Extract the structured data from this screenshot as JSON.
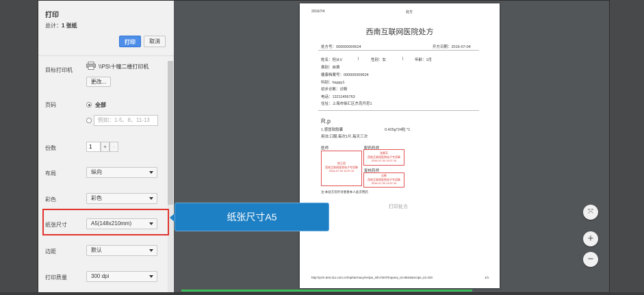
{
  "sidebar": {
    "title": "打印",
    "total_prefix": "总计：",
    "total_count": "1 张纸",
    "print_label": "打印",
    "cancel_label": "取消",
    "destination": {
      "label": "目标打印机",
      "printer": "\\\\PS\\十幢二楼打印机",
      "change_label": "更改..."
    },
    "pages": {
      "label": "页码",
      "all_label": "全部",
      "range_placeholder": "例如：1-5、8、11-13"
    },
    "copies": {
      "label": "份数",
      "value": "1",
      "plus": "+",
      "minus": "-"
    },
    "layout": {
      "label": "布局",
      "value": "纵向"
    },
    "color": {
      "label": "彩色",
      "value": "彩色"
    },
    "paper_size": {
      "label": "纸张尺寸",
      "value": "A5(148x210mm)"
    },
    "margins": {
      "label": "边距",
      "value": "默认"
    },
    "quality": {
      "label": "打印质量",
      "value": "300 dpi"
    }
  },
  "preview": {
    "header_date": "2016/7/4",
    "header_title": "处方",
    "doc_title": "西南互联网医院处方",
    "rx_no": "处方号：000000009524",
    "rx_date": "开方日期：2016-07-04",
    "name": "姓名：但从V",
    "gender": "性别：女",
    "age": "年龄：1月",
    "fee": "费别：自费",
    "record_no": "健康档案号：000000009524",
    "dept": "科别：happy1",
    "diagnosis": "初步诊断：诊断",
    "phone": "电话：13211456763",
    "address": "住址：上海市徐汇区杰克丹尼1",
    "rp": "R.p",
    "drug": "1.感冒软胶囊",
    "dose": "0.425g*24粒 *1",
    "usage": "用法:口服,每次1片,每天三次",
    "doctor_label": "医师",
    "pharm_label": "配药药师",
    "check_label": "复核药师",
    "doctor_stamp": [
      "地王君",
      "西南互联网医院电子专用章",
      "2016-07-04 11:57:14"
    ],
    "pharm_stamp": [
      "张卿芳",
      "西南互联网医院电子专用章",
      "2016-07-04 11:57:14"
    ],
    "check_stamp": [
      "诊断",
      "西南互联网医院电子专用章",
      "2016-07-04 11:57:14"
    ],
    "note": "注:本处方仅针对患者本人此次用药",
    "center": "打印处方",
    "footer_url": "http://yzm.test.111.com.cn/mpharmacy/recipe_info.html?inquery_id=9524&recipe_id=433",
    "page_num": "1/1"
  },
  "zoom": {
    "fit": "⤧",
    "in": "+",
    "out": "−"
  },
  "callout": "纸张尺寸A5"
}
